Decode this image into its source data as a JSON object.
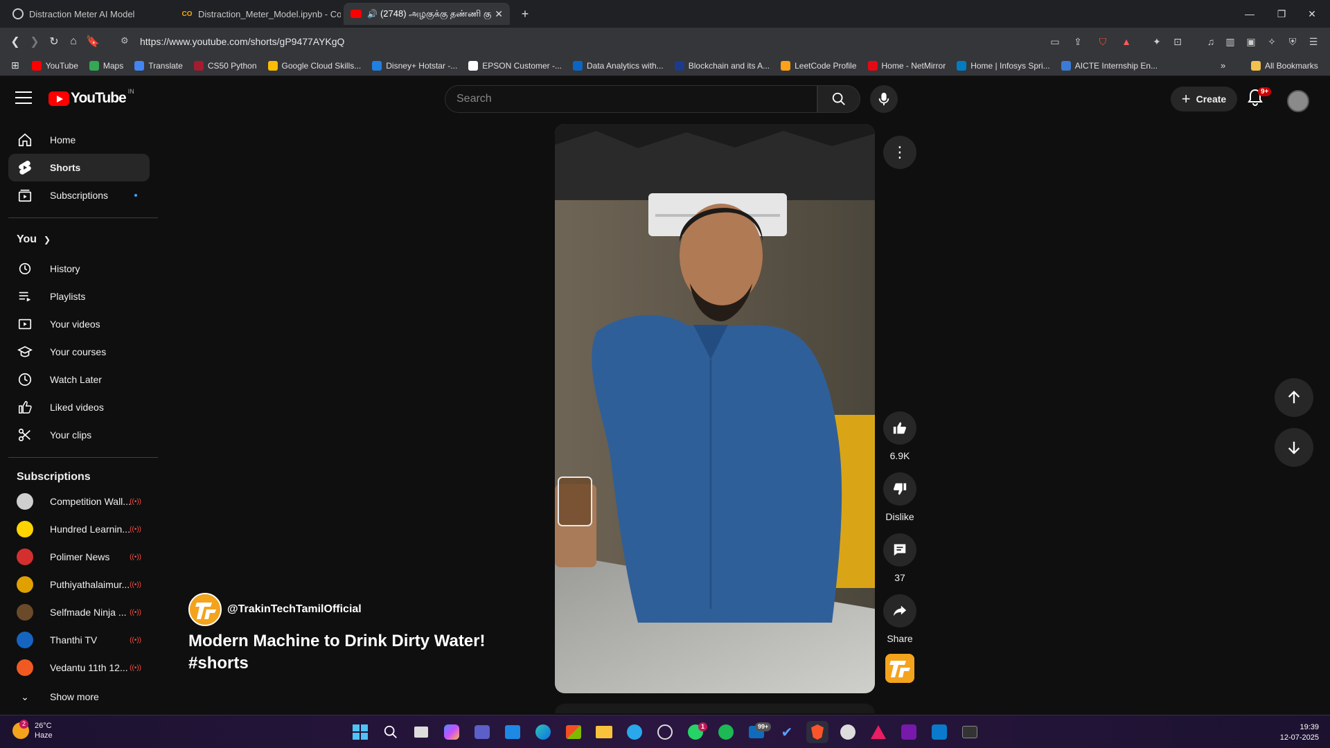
{
  "browser": {
    "tabs": [
      {
        "title": "Distraction Meter AI Model",
        "favicon": "browser-page-icon"
      },
      {
        "title": "Distraction_Meter_Model.ipynb - Col",
        "favicon": "colab-icon"
      },
      {
        "title": "(2748) அழகுக்கு தண்ணி கு",
        "favicon": "youtube-icon",
        "audio": true
      }
    ],
    "url": "https://www.youtube.com/shorts/gP9477AYKgQ",
    "bookmarks": [
      {
        "label": "YouTube",
        "color": "#ff0000"
      },
      {
        "label": "Maps",
        "color": "#34a853"
      },
      {
        "label": "Translate",
        "color": "#4285f4"
      },
      {
        "label": "CS50 Python",
        "color": "#a51c30"
      },
      {
        "label": "Google Cloud Skills...",
        "color": "#fbbc04"
      },
      {
        "label": "Disney+ Hotstar -...",
        "color": "#1f80e0"
      },
      {
        "label": "EPSON Customer -...",
        "color": "#ffffff"
      },
      {
        "label": "Data Analytics with...",
        "color": "#0a66c2"
      },
      {
        "label": "Blockchain and its A...",
        "color": "#1e3a8a"
      },
      {
        "label": "LeetCode Profile",
        "color": "#ffa116"
      },
      {
        "label": "Home - NetMirror",
        "color": "#e50914"
      },
      {
        "label": "Home | Infosys Spri...",
        "color": "#007cc3"
      },
      {
        "label": "AICTE Internship En...",
        "color": "#3a7bd5"
      }
    ],
    "all_bookmarks": "All Bookmarks"
  },
  "masthead": {
    "logo": "YouTube",
    "country": "IN",
    "search_placeholder": "Search",
    "create": "Create",
    "notifications_badge": "9+"
  },
  "sidebar": {
    "main": [
      {
        "label": "Home",
        "icon": "home-icon"
      },
      {
        "label": "Shorts",
        "icon": "shorts-icon",
        "active": true
      },
      {
        "label": "Subscriptions",
        "icon": "subscriptions-icon",
        "new_dot": true
      }
    ],
    "you_heading": "You",
    "you": [
      {
        "label": "History",
        "icon": "history-icon"
      },
      {
        "label": "Playlists",
        "icon": "playlists-icon"
      },
      {
        "label": "Your videos",
        "icon": "your-videos-icon"
      },
      {
        "label": "Your courses",
        "icon": "courses-icon"
      },
      {
        "label": "Watch Later",
        "icon": "watch-later-icon"
      },
      {
        "label": "Liked videos",
        "icon": "liked-videos-icon"
      },
      {
        "label": "Your clips",
        "icon": "clips-icon"
      }
    ],
    "subs_heading": "Subscriptions",
    "subscriptions": [
      {
        "label": "Competition Wall...",
        "color": "#cfcfcf",
        "live": true
      },
      {
        "label": "Hundred Learnin...",
        "color": "#ffd400",
        "live": true
      },
      {
        "label": "Polimer News",
        "color": "#d32f2f",
        "live": true
      },
      {
        "label": "Puthiyathalaimur...",
        "color": "#e0a000",
        "live": true
      },
      {
        "label": "Selfmade Ninja ...",
        "color": "#6b4a2a",
        "live": true
      },
      {
        "label": "Thanthi TV",
        "color": "#1565c0",
        "live": true
      },
      {
        "label": "Vedantu 11th 12...",
        "color": "#f05a22",
        "live": true
      }
    ],
    "show_more": "Show more"
  },
  "short": {
    "channel": "@TrakinTechTamilOfficial",
    "title": "Modern Machine to Drink Dirty Water! #shorts",
    "likes": "6.9K",
    "dislike_label": "Dislike",
    "comments": "37",
    "share_label": "Share"
  },
  "taskbar": {
    "weather_badge": "2",
    "temperature": "26°C",
    "condition": "Haze",
    "whatsapp_badge": "1",
    "mail_badge": "99+",
    "time": "19:39",
    "date": "12-07-2025"
  }
}
